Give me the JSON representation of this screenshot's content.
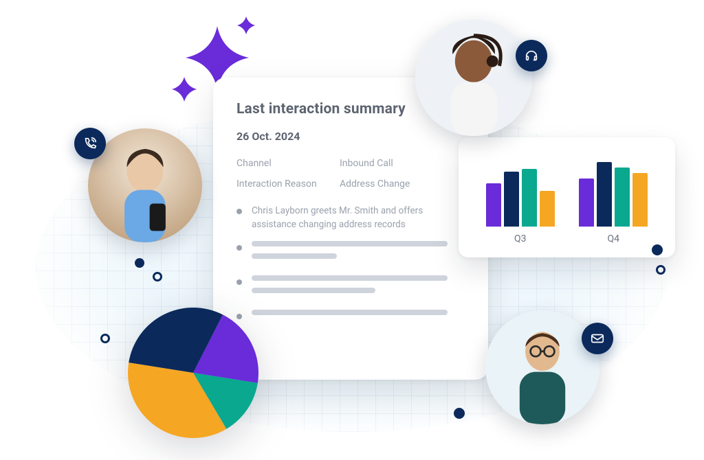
{
  "colors": {
    "navy": "#0b2a5b",
    "purple": "#6a2bd9",
    "teal": "#0aa88f",
    "orange": "#f5a623",
    "grayText": "#9aa1ad",
    "headingText": "#5d6470"
  },
  "summary": {
    "title": "Last interaction summary",
    "date": "26 Oct. 2024",
    "fields": {
      "channel_label": "Channel",
      "channel_value": "Inbound Call",
      "reason_label": "Interaction Reason",
      "reason_value": "Address Change"
    },
    "bullet_text": "Chris Layborn greets Mr. Smith and offers assistance changing address records"
  },
  "chart_data": [
    {
      "type": "bar",
      "title": "",
      "categories": [
        "Q3",
        "Q4"
      ],
      "series": [
        {
          "name": "Purple",
          "color": "#6a2bd9",
          "values": [
            63,
            70
          ]
        },
        {
          "name": "Navy",
          "color": "#0b2a5b",
          "values": [
            80,
            94
          ]
        },
        {
          "name": "Teal",
          "color": "#0aa88f",
          "values": [
            84,
            86
          ]
        },
        {
          "name": "Orange",
          "color": "#f5a623",
          "values": [
            52,
            78
          ]
        }
      ],
      "ylim": [
        0,
        100
      ],
      "xlabel": "",
      "ylabel": ""
    },
    {
      "type": "pie",
      "title": "",
      "slices": [
        {
          "name": "Orange",
          "color": "#f5a623",
          "value": 36
        },
        {
          "name": "Navy",
          "color": "#0b2a5b",
          "value": 30
        },
        {
          "name": "Purple",
          "color": "#6a2bd9",
          "value": 20
        },
        {
          "name": "Teal",
          "color": "#0aa88f",
          "value": 14
        }
      ]
    }
  ],
  "avatars": [
    {
      "id": "avatar-call",
      "badge_icon": "phone-icon"
    },
    {
      "id": "avatar-headset",
      "badge_icon": "headset-icon"
    },
    {
      "id": "avatar-email",
      "badge_icon": "mail-icon"
    }
  ],
  "barcard_labels": {
    "q3": "Q3",
    "q4": "Q4"
  }
}
